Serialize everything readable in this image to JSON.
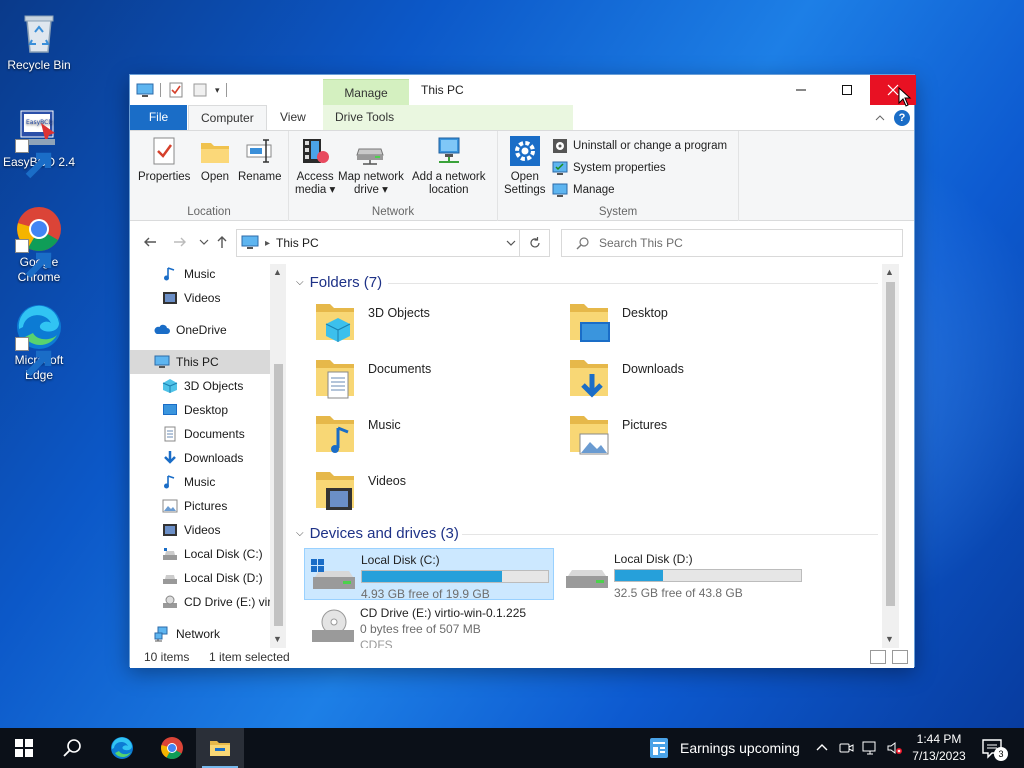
{
  "desktop": {
    "icons": [
      {
        "label": "Recycle Bin",
        "icon": "recycle-bin-icon"
      },
      {
        "label": "EasyBCD 2.4",
        "icon": "easybcd-icon"
      },
      {
        "label": "Google Chrome",
        "icon": "chrome-icon"
      },
      {
        "label": "Microsoft Edge",
        "icon": "edge-icon"
      }
    ]
  },
  "window": {
    "title": "This PC",
    "context_tab_group": "Manage",
    "tabs": {
      "file": "File",
      "computer": "Computer",
      "view": "View",
      "drive_tools": "Drive Tools"
    },
    "ribbon": {
      "location": {
        "label": "Location",
        "properties": "Properties",
        "open": "Open",
        "rename": "Rename"
      },
      "network": {
        "label": "Network",
        "access_media_1": "Access",
        "access_media_2": "media",
        "map_drive_1": "Map network",
        "map_drive_2": "drive",
        "add_location_1": "Add a network",
        "add_location_2": "location"
      },
      "system": {
        "label": "System",
        "open_settings_1": "Open",
        "open_settings_2": "Settings",
        "uninstall": "Uninstall or change a program",
        "system_properties": "System properties",
        "manage": "Manage"
      }
    },
    "address": {
      "path": "This PC"
    },
    "search": {
      "placeholder": "Search This PC"
    },
    "nav_pane": {
      "items": [
        {
          "label": "Music",
          "icon": "music-icon",
          "indent": 1
        },
        {
          "label": "Videos",
          "icon": "videos-icon",
          "indent": 1
        },
        {
          "label": "OneDrive",
          "icon": "onedrive-icon",
          "indent": 0
        },
        {
          "label": "This PC",
          "icon": "pc-icon",
          "indent": 0,
          "selected": true
        },
        {
          "label": "3D Objects",
          "icon": "3d-objects-icon",
          "indent": 1
        },
        {
          "label": "Desktop",
          "icon": "desktop-icon",
          "indent": 1
        },
        {
          "label": "Documents",
          "icon": "documents-icon",
          "indent": 1
        },
        {
          "label": "Downloads",
          "icon": "downloads-icon",
          "indent": 1
        },
        {
          "label": "Music",
          "icon": "music-icon",
          "indent": 1
        },
        {
          "label": "Pictures",
          "icon": "pictures-icon",
          "indent": 1
        },
        {
          "label": "Videos",
          "icon": "videos-icon",
          "indent": 1
        },
        {
          "label": "Local Disk (C:)",
          "icon": "drive-icon",
          "indent": 1
        },
        {
          "label": "Local Disk (D:)",
          "icon": "drive-icon",
          "indent": 1
        },
        {
          "label": "CD Drive (E:) virt",
          "icon": "cd-drive-icon",
          "indent": 1
        },
        {
          "label": "Network",
          "icon": "network-icon",
          "indent": 0
        }
      ]
    },
    "content": {
      "folders_header": "Folders (7)",
      "folders": [
        {
          "label": "3D Objects",
          "icon": "3d-objects-icon"
        },
        {
          "label": "Desktop",
          "icon": "desktop-icon"
        },
        {
          "label": "Documents",
          "icon": "documents-icon"
        },
        {
          "label": "Downloads",
          "icon": "downloads-icon"
        },
        {
          "label": "Music",
          "icon": "music-icon"
        },
        {
          "label": "Pictures",
          "icon": "pictures-icon"
        },
        {
          "label": "Videos",
          "icon": "videos-icon"
        }
      ],
      "drives_header": "Devices and drives (3)",
      "drives": [
        {
          "label": "Local Disk (C:)",
          "free": "4.93 GB free of 19.9 GB",
          "used_fraction": 0.75,
          "selected": true
        },
        {
          "label": "Local Disk (D:)",
          "free": "32.5 GB free of 43.8 GB",
          "used_fraction": 0.26,
          "selected": false
        },
        {
          "label": "CD Drive (E:) virtio-win-0.1.225",
          "free": "0 bytes free of 507 MB",
          "sub": "CDFS"
        }
      ]
    },
    "status": {
      "count": "10 items",
      "selection": "1 item selected"
    }
  },
  "taskbar": {
    "weather": "Earnings upcoming",
    "time": "1:44 PM",
    "date": "7/13/2023",
    "notifications": "3"
  },
  "colors": {
    "accent": "#1a6dc7",
    "close": "#e81123",
    "drive_fill": "#26a0da",
    "selection": "#cce8ff"
  }
}
